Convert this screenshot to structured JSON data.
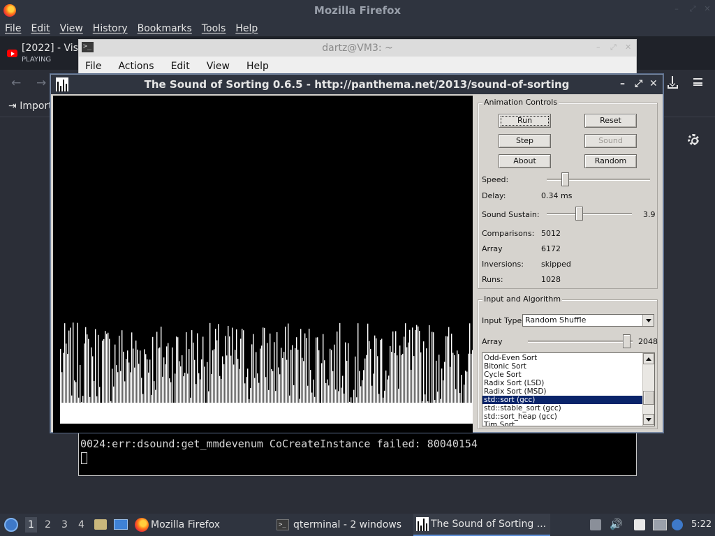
{
  "firefox": {
    "window_title": "Mozilla Firefox",
    "menu": [
      "File",
      "Edit",
      "View",
      "History",
      "Bookmarks",
      "Tools",
      "Help"
    ],
    "tab": {
      "title": "[2022] - Visu",
      "status": "PLAYING"
    },
    "bookmarks_import": "Import"
  },
  "qterminal": {
    "window_title": "dartz@VM3: ~",
    "menu": [
      "File",
      "Actions",
      "Edit",
      "View",
      "Help"
    ],
    "lines": [
      "0024:err:dsound:get_mmdevenum CoCreateInstance failed: 80040154"
    ],
    "partial_line": "0024:err:dsound:get_mmdevenum CoCreateInstance failed: 80040154"
  },
  "sos": {
    "window_title": "The Sound of Sorting 0.6.5 - http://panthema.net/2013/sound-of-sorting",
    "animation_controls": {
      "legend": "Animation Controls",
      "buttons": {
        "run": "Run",
        "reset": "Reset",
        "step": "Step",
        "sound": "Sound",
        "about": "About",
        "random": "Random"
      },
      "speed_label": "Speed:",
      "speed_level": 0.15,
      "delay_label": "Delay:",
      "delay_value": "0.34 ms",
      "sustain_label": "Sound Sustain:",
      "sustain_value": "3.9",
      "sustain_level": 0.37,
      "stats": [
        {
          "label": "Comparisons:",
          "value": "5012"
        },
        {
          "label": "Array",
          "value": "6172"
        },
        {
          "label": "Inversions:",
          "value": "skipped"
        },
        {
          "label": "Runs:",
          "value": "1028"
        }
      ]
    },
    "input_algorithm": {
      "legend": "Input and Algorithm",
      "input_type_label": "Input Type:",
      "input_type_value": "Random Shuffle",
      "array_label": "Array",
      "array_value": "2048",
      "array_level": 0.98,
      "algorithms": [
        "Odd-Even Sort",
        "Bitonic Sort",
        "Cycle Sort",
        "Radix Sort (LSD)",
        "Radix Sort (MSD)",
        "std::sort (gcc)",
        "std::stable_sort (gcc)",
        "std::sort_heap (gcc)",
        "Tim Sort"
      ],
      "selected_algorithm": "std::sort (gcc)"
    }
  },
  "taskbar": {
    "workspaces": [
      "1",
      "2",
      "3",
      "4"
    ],
    "active_workspace": "1",
    "tasks": [
      "Mozilla Firefox",
      "qterminal - 2 windows",
      "The Sound of Sorting ..."
    ],
    "clock": "5:22"
  },
  "colors": {
    "panel_dark": "#2f343f",
    "qt_background": "#d6d3ce",
    "selection": "#0a246a"
  }
}
